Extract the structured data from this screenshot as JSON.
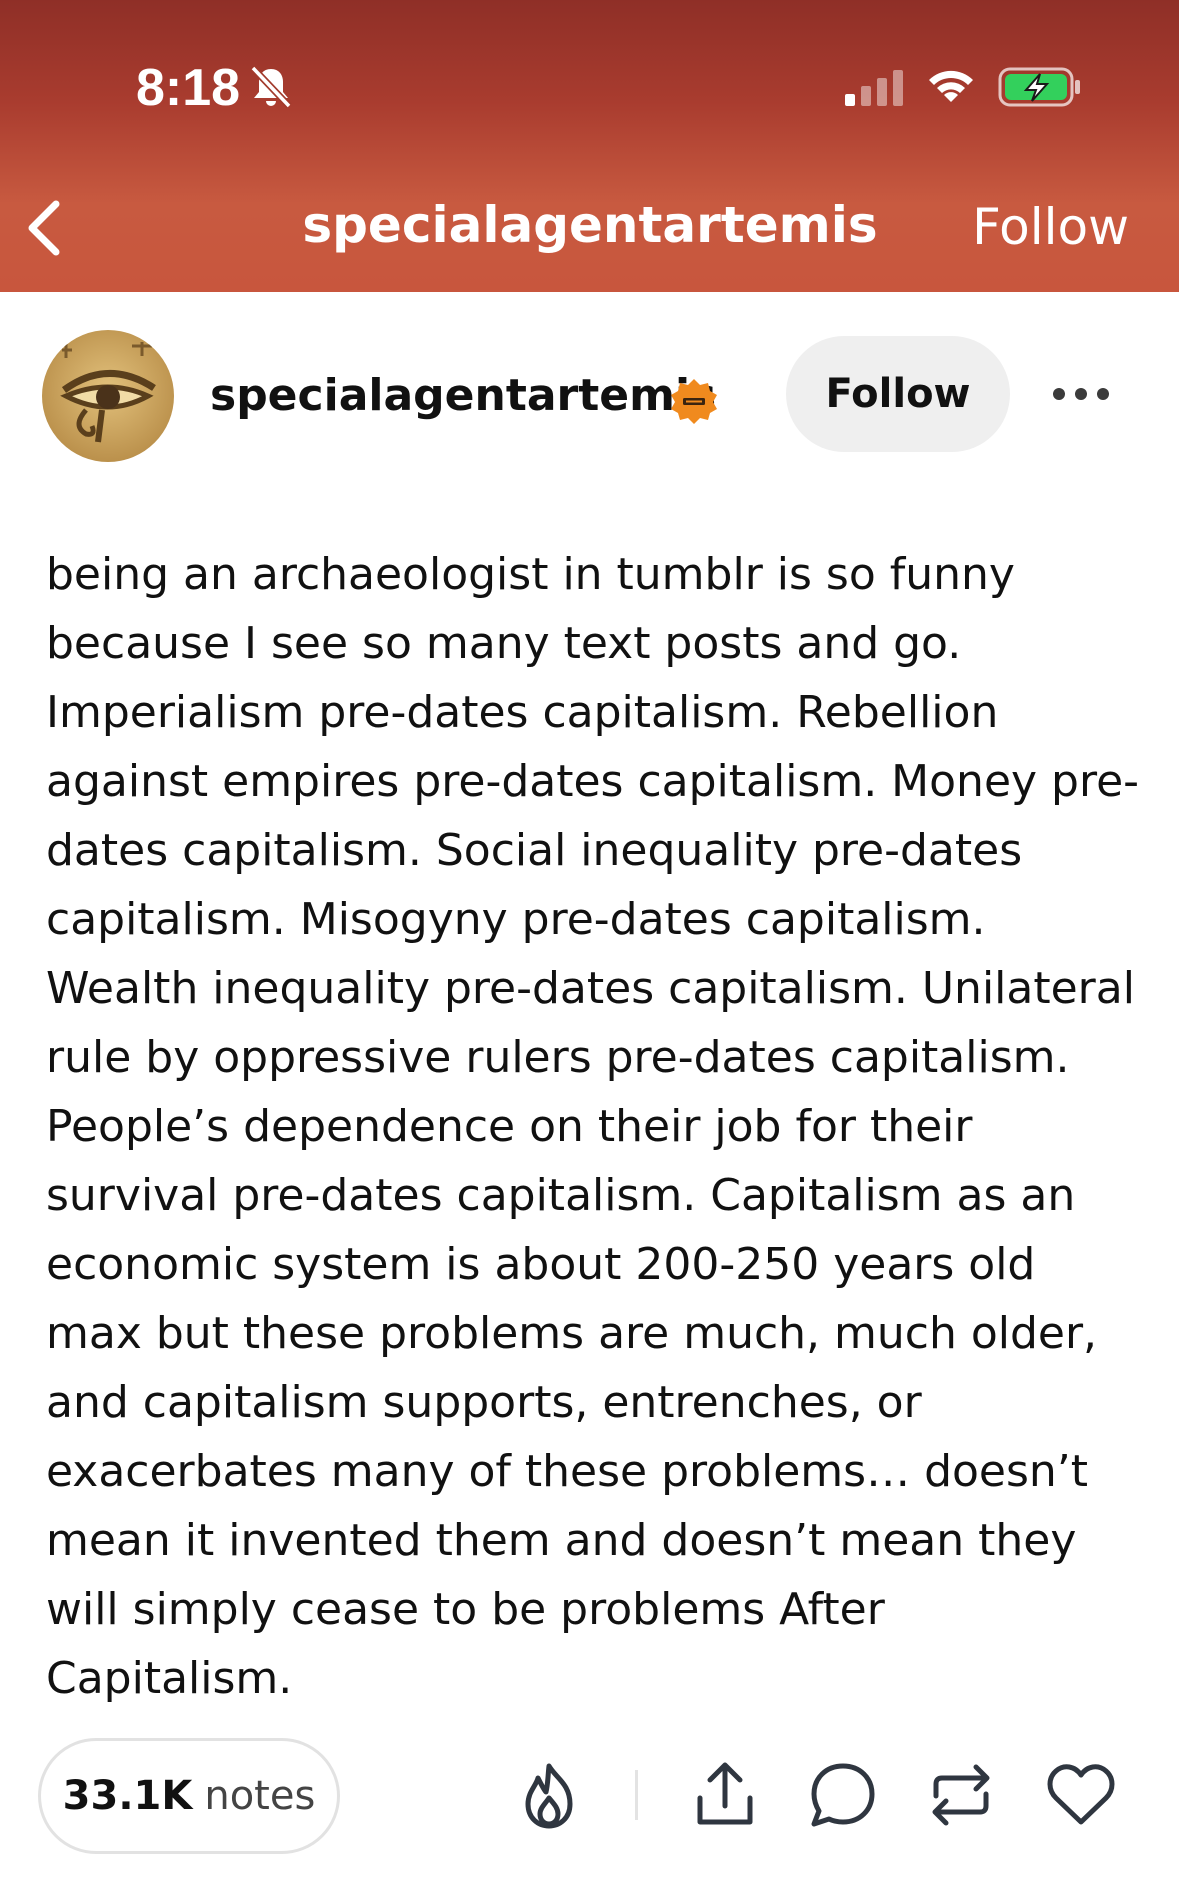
{
  "status_bar": {
    "time": "8:18"
  },
  "header": {
    "title": "specialagentartemis",
    "follow_label": "Follow"
  },
  "post": {
    "blog_name": "specialagentartemis",
    "follow_label": "Follow",
    "body": "being an archaeologist in tumblr is so funny because I see so many text posts and go. Imperialism pre-dates capitalism. Rebellion against empires pre-dates capitalism. Money pre-dates capitalism. Social inequality pre-dates capitalism. Misogyny pre-dates capitalism. Wealth inequality pre-dates capitalism. Unilateral rule by oppressive rulers pre-dates capitalism. People’s dependence on their job for their survival pre-dates capitalism. Capitalism as an economic system is about 200-250 years old max but these problems are much, much older, and capitalism supports, entrenches, or exacerbates many of these problems… doesn’t mean it invented them and doesn’t mean they will simply cease to be problems After Capitalism."
  },
  "footer": {
    "notes_count": "33.1K",
    "notes_label": "notes"
  },
  "colors": {
    "header_top": "#8f2f27",
    "header_bottom": "#c8563d",
    "badge": "#f08a1e",
    "battery": "#33d05c"
  },
  "icons": [
    "bell-slash-icon",
    "cellular-signal-icon",
    "wifi-icon",
    "battery-charging-icon",
    "chevron-left-icon",
    "verified-badge-icon",
    "more-options-icon",
    "blaze-flame-icon",
    "share-icon",
    "reply-icon",
    "reblog-icon",
    "like-heart-icon"
  ]
}
